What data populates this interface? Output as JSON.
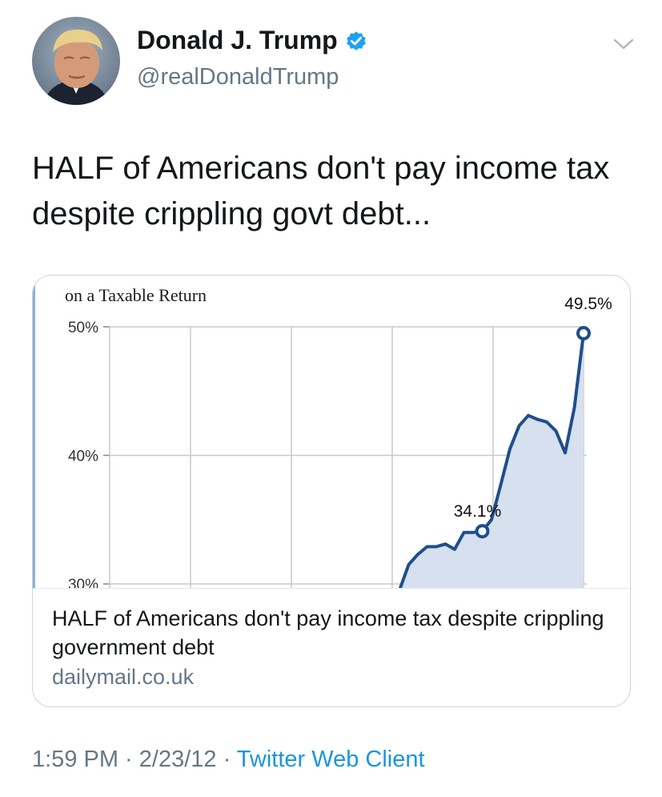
{
  "author": {
    "name": "Donald J. Trump",
    "handle": "@realDonaldTrump",
    "verified": true,
    "avatar_icon": "profile-photo",
    "verified_color": "#1da1f2"
  },
  "tweet": {
    "text": "HALF of Americans don't pay income tax despite crippling govt debt..."
  },
  "card": {
    "title": "HALF of Americans don't pay income tax despite crippling government debt",
    "domain": "dailymail.co.uk"
  },
  "chart_data": {
    "type": "area",
    "title": "on a Taxable Return",
    "y_ticks": [
      "50%",
      "40%",
      "30%"
    ],
    "ylim": [
      30,
      50
    ],
    "x": [
      0.0,
      0.5,
      1.0,
      1.5,
      2.0,
      2.5,
      3.0,
      3.5,
      4.0,
      4.5,
      5.0,
      5.5,
      6.0,
      6.5,
      7.0,
      7.5,
      8.0,
      8.5,
      9.0,
      9.5,
      10.0,
      10.5,
      11.0
    ],
    "values": [
      29.5,
      31.5,
      32.3,
      32.9,
      32.9,
      33.1,
      32.7,
      34.0,
      34.0,
      34.1,
      35.0,
      37.7,
      40.5,
      42.3,
      43.1,
      42.8,
      42.6,
      41.9,
      40.2,
      43.7,
      49.5
    ],
    "annotations": [
      {
        "label": "34.1%",
        "x": 9.0,
        "value": 34.1
      },
      {
        "label": "49.5%",
        "x": 18.0,
        "value": 49.5
      }
    ],
    "series_color": "#1f4e8c",
    "fill_color": "#d6e0ee",
    "grid": true
  },
  "meta": {
    "time": "1:59 PM",
    "sep1": " · ",
    "date": "2/23/12",
    "sep2": " · ",
    "source": "Twitter Web Client"
  }
}
